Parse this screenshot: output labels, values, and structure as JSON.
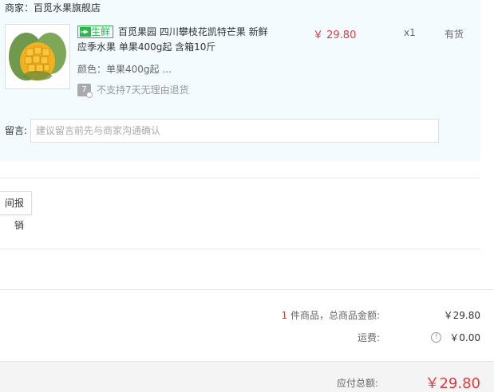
{
  "merchant": {
    "label": "商家：",
    "name": "百觅水果旗舰店"
  },
  "product": {
    "tag": "生鲜",
    "title": "百觅果园 四川攀枝花凯特芒果 新鲜应季水果 单果400g起 含箱10斤",
    "spec": "颜色：单果400g起 ...",
    "return_policy": "不支持7天无理由退货",
    "return_icon_text": "7",
    "price": "￥ 29.80",
    "quantity": "x1",
    "stock": "有货",
    "image_icon": "mango-image"
  },
  "note": {
    "label": "留言:",
    "placeholder": "建议留言前先与商家沟通确认"
  },
  "invoice": {
    "button_label": "间报销"
  },
  "summary": {
    "count": "1",
    "count_suffix": " 件商品，总商品金额:",
    "goods_total": "￥29.80",
    "shipping_label": "运费:",
    "shipping_value": "￥0.00",
    "info_icon": "info-icon"
  },
  "total": {
    "label": "应付总额:",
    "value": "￥29.80"
  },
  "colors": {
    "price_red": "#e4393c",
    "fresh_green": "#2db54a",
    "panel_bg": "#f3fbfe"
  }
}
